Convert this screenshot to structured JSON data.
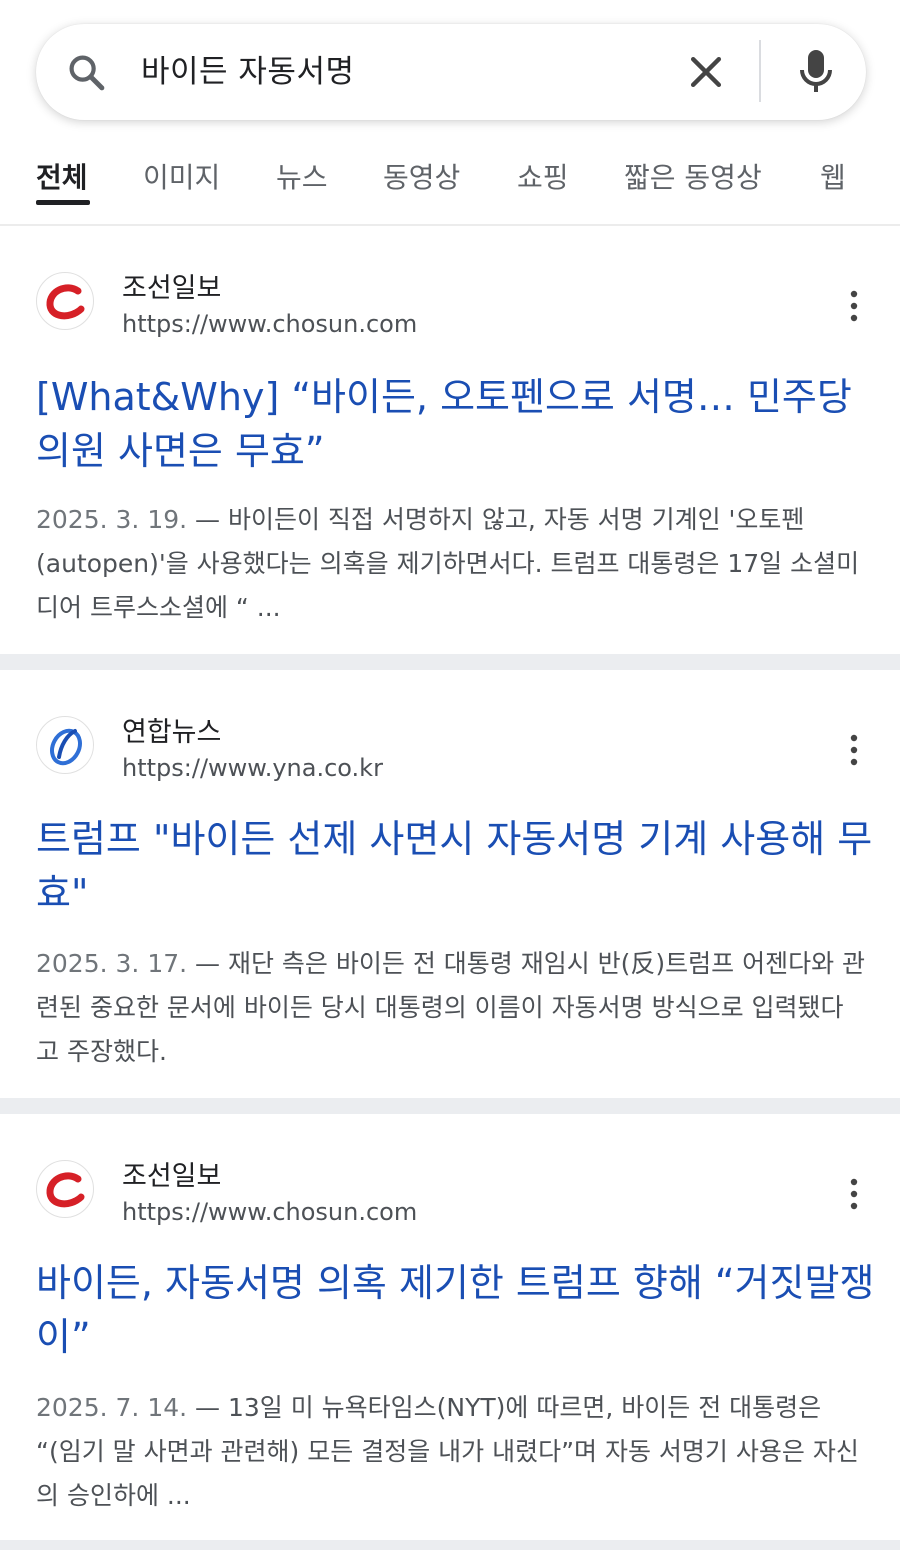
{
  "search": {
    "query": "바이든 자동서명"
  },
  "tabs": [
    {
      "label": "전체",
      "active": true
    },
    {
      "label": "이미지"
    },
    {
      "label": "뉴스"
    },
    {
      "label": "동영상"
    },
    {
      "label": "쇼핑"
    },
    {
      "label": "짧은 동영상"
    },
    {
      "label": "웹"
    }
  ],
  "results": [
    {
      "site": "조선일보",
      "url": "https://www.chosun.com",
      "favicon": "chosun-logo-icon",
      "title": "[What&Why] “바이든, 오토펜으로 서명… 민주당 의원 사면은 무효”",
      "date": "2025. 3. 19.",
      "snippet": " — 바이든이 직접 서명하지 않고, 자동 서명 기계인 '오토펜(autopen)'을 사용했다는 의혹을 제기하면서다. 트럼프 대통령은 17일 소셜미디어 트루스소셜에 “ ..."
    },
    {
      "site": "연합뉴스",
      "url": "https://www.yna.co.kr",
      "favicon": "yonhap-logo-icon",
      "title": "트럼프 \"바이든 선제 사면시 자동서명 기계 사용해 무효\"",
      "date": "2025. 3. 17.",
      "snippet": " — 재단 측은 바이든 전 대통령 재임시 반(反)트럼프 어젠다와 관련된 중요한 문서에 바이든 당시 대통령의 이름이 자동서명 방식으로 입력됐다고 주장했다."
    },
    {
      "site": "조선일보",
      "url": "https://www.chosun.com",
      "favicon": "chosun-logo-icon",
      "title": "바이든, 자동서명 의혹 제기한 트럼프 향해 “거짓말쟁이”",
      "date": "2025. 7. 14.",
      "snippet": " — 13일 미 뉴욕타임스(NYT)에 따르면, 바이든 전 대통령은 “(임기 말 사면과 관련해) 모든 결정을 내가 내렸다”며 자동 서명기 사용은 자신의 승인하에 ..."
    }
  ],
  "colors": {
    "link": "#1a4eb3",
    "text": "#202124",
    "muted": "#4d5156",
    "separator": "#ebedf0"
  }
}
